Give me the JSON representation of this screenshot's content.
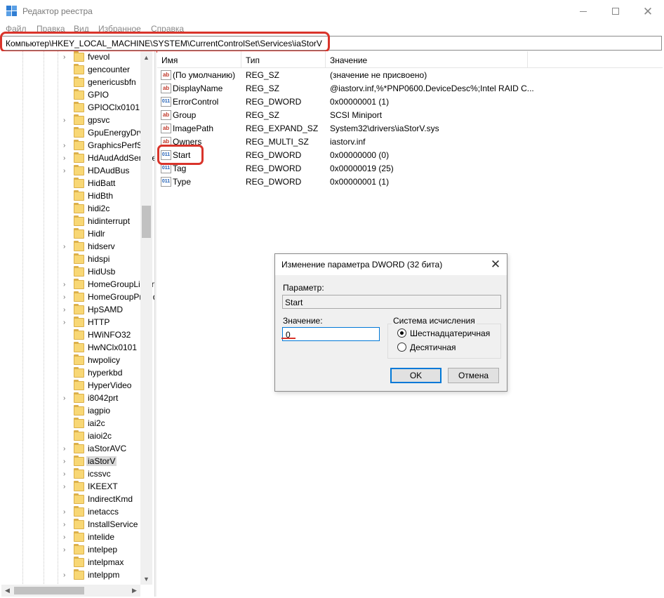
{
  "window": {
    "title": "Редактор реестра"
  },
  "menu": [
    "Файл",
    "Правка",
    "Вид",
    "Избранное",
    "Справка"
  ],
  "address": "Компьютер\\HKEY_LOCAL_MACHINE\\SYSTEM\\CurrentControlSet\\Services\\iaStorV",
  "tree": {
    "items": [
      {
        "label": "fvevol",
        "expander": true
      },
      {
        "label": "gencounter",
        "expander": false
      },
      {
        "label": "genericusbfn",
        "expander": false
      },
      {
        "label": "GPIO",
        "expander": false
      },
      {
        "label": "GPIOClx0101",
        "expander": false
      },
      {
        "label": "gpsvc",
        "expander": true
      },
      {
        "label": "GpuEnergyDrv",
        "expander": false
      },
      {
        "label": "GraphicsPerfSvc",
        "expander": true
      },
      {
        "label": "HdAudAddService",
        "expander": true
      },
      {
        "label": "HDAudBus",
        "expander": true
      },
      {
        "label": "HidBatt",
        "expander": false
      },
      {
        "label": "HidBth",
        "expander": false
      },
      {
        "label": "hidi2c",
        "expander": false
      },
      {
        "label": "hidinterrupt",
        "expander": false
      },
      {
        "label": "Hidlr",
        "expander": false
      },
      {
        "label": "hidserv",
        "expander": true
      },
      {
        "label": "hidspi",
        "expander": false
      },
      {
        "label": "HidUsb",
        "expander": false
      },
      {
        "label": "HomeGroupListener",
        "expander": true
      },
      {
        "label": "HomeGroupProvider",
        "expander": true
      },
      {
        "label": "HpSAMD",
        "expander": true
      },
      {
        "label": "HTTP",
        "expander": true
      },
      {
        "label": "HWiNFO32",
        "expander": false
      },
      {
        "label": "HwNClx0101",
        "expander": false
      },
      {
        "label": "hwpolicy",
        "expander": false
      },
      {
        "label": "hyperkbd",
        "expander": false
      },
      {
        "label": "HyperVideo",
        "expander": false
      },
      {
        "label": "i8042prt",
        "expander": true
      },
      {
        "label": "iagpio",
        "expander": false
      },
      {
        "label": "iai2c",
        "expander": false
      },
      {
        "label": "iaioi2c",
        "expander": false
      },
      {
        "label": "iaStorAVC",
        "expander": true
      },
      {
        "label": "iaStorV",
        "expander": true,
        "selected": true
      },
      {
        "label": "icssvc",
        "expander": true
      },
      {
        "label": "IKEEXT",
        "expander": true
      },
      {
        "label": "IndirectKmd",
        "expander": false
      },
      {
        "label": "inetaccs",
        "expander": true
      },
      {
        "label": "InstallService",
        "expander": true
      },
      {
        "label": "intelide",
        "expander": true
      },
      {
        "label": "intelpep",
        "expander": true
      },
      {
        "label": "intelpmax",
        "expander": false
      },
      {
        "label": "intelppm",
        "expander": true
      }
    ]
  },
  "list": {
    "columns": [
      "Имя",
      "Тип",
      "Значение"
    ],
    "rows": [
      {
        "name": "(По умолчанию)",
        "type": "REG_SZ",
        "value": "(значение не присвоено)",
        "icon": "string-value-icon",
        "glyph": "ab"
      },
      {
        "name": "DisplayName",
        "type": "REG_SZ",
        "value": "@iastorv.inf,%*PNP0600.DeviceDesc%;Intel RAID C...",
        "icon": "string-value-icon",
        "glyph": "ab"
      },
      {
        "name": "ErrorControl",
        "type": "REG_DWORD",
        "value": "0x00000001 (1)",
        "icon": "binary-value-icon",
        "glyph": "011"
      },
      {
        "name": "Group",
        "type": "REG_SZ",
        "value": "SCSI Miniport",
        "icon": "string-value-icon",
        "glyph": "ab"
      },
      {
        "name": "ImagePath",
        "type": "REG_EXPAND_SZ",
        "value": "System32\\drivers\\iaStorV.sys",
        "icon": "string-value-icon",
        "glyph": "ab"
      },
      {
        "name": "Owners",
        "type": "REG_MULTI_SZ",
        "value": "iastorv.inf",
        "icon": "string-value-icon",
        "glyph": "ab"
      },
      {
        "name": "Start",
        "type": "REG_DWORD",
        "value": "0x00000000 (0)",
        "icon": "binary-value-icon",
        "glyph": "011"
      },
      {
        "name": "Tag",
        "type": "REG_DWORD",
        "value": "0x00000019 (25)",
        "icon": "binary-value-icon",
        "glyph": "011"
      },
      {
        "name": "Type",
        "type": "REG_DWORD",
        "value": "0x00000001 (1)",
        "icon": "binary-value-icon",
        "glyph": "011"
      }
    ]
  },
  "dialog": {
    "title": "Изменение параметра DWORD (32 бита)",
    "param_label": "Параметр:",
    "param_value": "Start",
    "value_label": "Значение:",
    "value": "0",
    "radix_label": "Система исчисления",
    "radix_options": [
      "Шестнадцатеричная",
      "Десятичная"
    ],
    "radix_selected": 0,
    "ok_label": "OK",
    "cancel_label": "Отмена"
  },
  "colors": {
    "highlight": "#d9342b",
    "folder": "#f8d775",
    "focus": "#0078d7"
  }
}
